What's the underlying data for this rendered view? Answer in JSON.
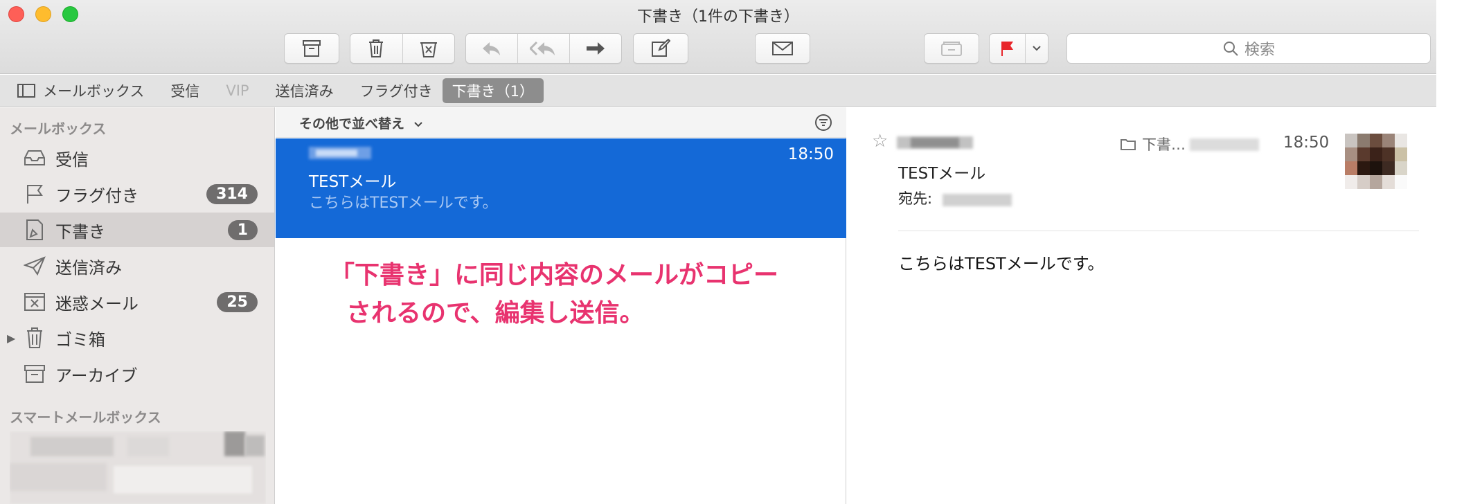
{
  "window": {
    "title": "下書き（1件の下書き）"
  },
  "toolbar": {
    "icons": [
      "archive-icon",
      "trash-icon",
      "junk-icon",
      "reply-icon",
      "reply-all-icon",
      "forward-icon",
      "compose-icon",
      "get-mail-icon",
      "move-icon",
      "flag-icon",
      "chevron-down-icon"
    ],
    "flag_color": "#e8262b",
    "search_placeholder": "検索"
  },
  "favorites": {
    "mailbox_label": "メールボックス",
    "items": [
      {
        "label": "受信",
        "state": "normal"
      },
      {
        "label": "VIP",
        "state": "disabled"
      },
      {
        "label": "送信済み",
        "state": "normal"
      },
      {
        "label": "フラグ付き",
        "state": "normal"
      },
      {
        "label": "下書き（1）",
        "state": "active"
      }
    ]
  },
  "sidebar": {
    "mailboxes_header": "メールボックス",
    "items": [
      {
        "label": "受信",
        "icon": "inbox-icon",
        "badge": ""
      },
      {
        "label": "フラグ付き",
        "icon": "flag-outline-icon",
        "badge": "314"
      },
      {
        "label": "下書き",
        "icon": "draft-icon",
        "badge": "1"
      },
      {
        "label": "送信済み",
        "icon": "paper-plane-icon",
        "badge": ""
      },
      {
        "label": "迷惑メール",
        "icon": "junk-box-icon",
        "badge": "25"
      },
      {
        "label": "ゴミ箱",
        "icon": "trash-can-icon",
        "badge": ""
      },
      {
        "label": "アーカイブ",
        "icon": "archive-box-icon",
        "badge": ""
      }
    ],
    "smart_header": "スマートメールボックス"
  },
  "message_list": {
    "sort_label": "その他で並べ替え",
    "messages": [
      {
        "time": "18:50",
        "subject": "TESTメール",
        "preview": "こちらはTESTメールです。"
      }
    ]
  },
  "annotation": {
    "line1": "「下書き」に同じ内容のメールがコピー",
    "line2": "されるので、編集し送信。",
    "color": "#e8336f"
  },
  "reader": {
    "folder": "下書…",
    "time": "18:50",
    "subject": "TESTメール",
    "to_label": "宛先:",
    "body": "こちらはTESTメールです。"
  },
  "colors": {
    "selection": "#1469d7",
    "accent_pink": "#e8336f"
  }
}
